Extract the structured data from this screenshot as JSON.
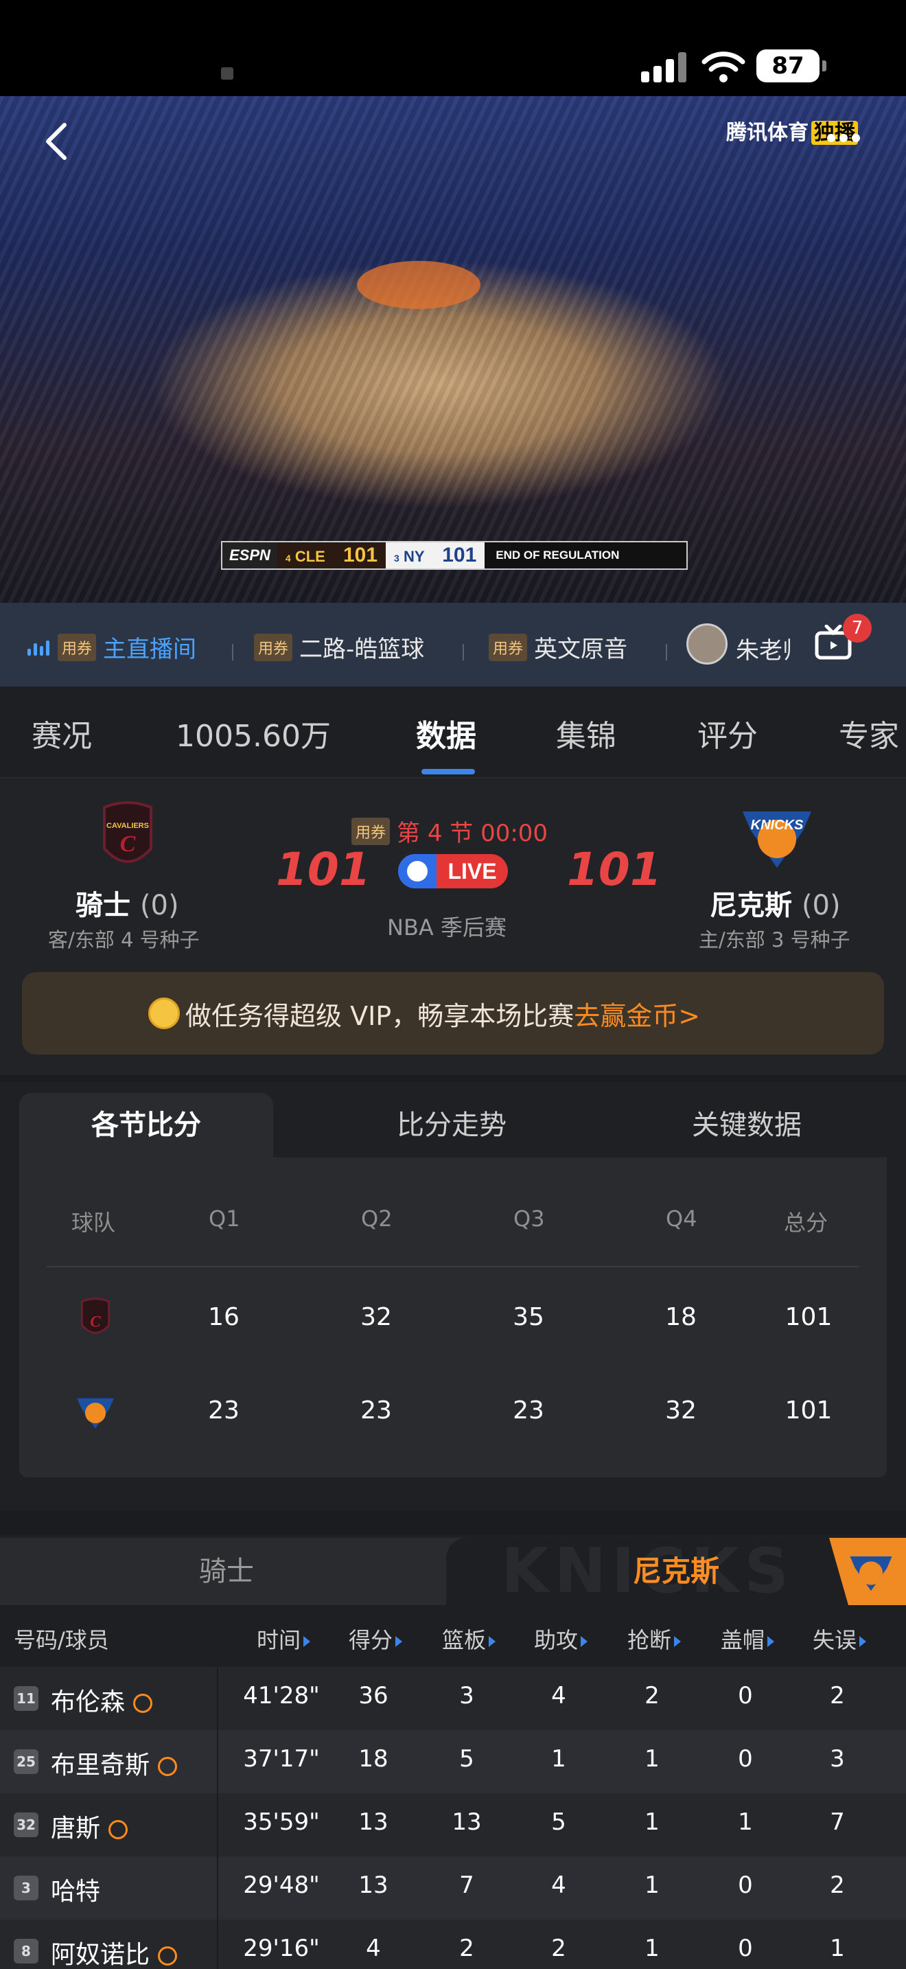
{
  "status": {
    "battery": "87"
  },
  "video": {
    "brand": "腾讯体育",
    "brand_exclusive": "独播",
    "scorebug": {
      "network": "ESPN",
      "away_seed": "4",
      "away_abbr": "CLE",
      "away_score": "101",
      "home_seed": "3",
      "home_abbr": "NY",
      "home_score": "101",
      "status": "END OF REGULATION"
    }
  },
  "streams": {
    "coupon": "用券",
    "items": [
      {
        "label": "主直播间",
        "active": true
      },
      {
        "label": "二路-皓篮球",
        "active": false
      },
      {
        "label": "英文原音",
        "active": false
      }
    ],
    "host_name": "朱老师",
    "tv_badge": "7"
  },
  "tabs": [
    "赛况",
    "1005.60万",
    "数据",
    "集锦",
    "评分",
    "专家"
  ],
  "match": {
    "coupon": "用券",
    "period": "第 4 节 00:00",
    "live": "LIVE",
    "league": "NBA 季后赛",
    "away": {
      "name": "骑士",
      "wins": "(0)",
      "sub": "客/东部 4 号种子",
      "score": "101"
    },
    "home": {
      "name": "尼克斯",
      "wins": "(0)",
      "sub": "主/东部 3 号种子",
      "score": "101"
    }
  },
  "vip": {
    "text": "做任务得超级 VIP，畅享本场比赛",
    "link": "去赢金币>"
  },
  "quarters": {
    "tabs": [
      "各节比分",
      "比分走势",
      "关键数据"
    ],
    "headers": [
      "球队",
      "Q1",
      "Q2",
      "Q3",
      "Q4",
      "总分"
    ],
    "rows": [
      {
        "team": "cavaliers",
        "values": [
          "16",
          "32",
          "35",
          "18",
          "101"
        ]
      },
      {
        "team": "knicks",
        "values": [
          "23",
          "23",
          "23",
          "32",
          "101"
        ]
      }
    ]
  },
  "players": {
    "tab_away": "骑士",
    "tab_home": "尼克斯",
    "watermark": "KNICKS",
    "headers": [
      "号码/球员",
      "时间",
      "得分",
      "篮板",
      "助攻",
      "抢断",
      "盖帽",
      "失误"
    ],
    "rows": [
      {
        "num": "11",
        "name": "布伦森",
        "starter": true,
        "time": "41'28\"",
        "pts": "36",
        "reb": "3",
        "ast": "4",
        "stl": "2",
        "blk": "0",
        "tov": "2"
      },
      {
        "num": "25",
        "name": "布里奇斯",
        "starter": true,
        "time": "37'17\"",
        "pts": "18",
        "reb": "5",
        "ast": "1",
        "stl": "1",
        "blk": "0",
        "tov": "3"
      },
      {
        "num": "32",
        "name": "唐斯",
        "starter": true,
        "time": "35'59\"",
        "pts": "13",
        "reb": "13",
        "ast": "5",
        "stl": "1",
        "blk": "1",
        "tov": "7"
      },
      {
        "num": "3",
        "name": "哈特",
        "starter": false,
        "time": "29'48\"",
        "pts": "13",
        "reb": "7",
        "ast": "4",
        "stl": "1",
        "blk": "0",
        "tov": "2"
      },
      {
        "num": "8",
        "name": "阿奴诺比",
        "starter": true,
        "time": "29'16\"",
        "pts": "4",
        "reb": "2",
        "ast": "2",
        "stl": "1",
        "blk": "0",
        "tov": "1"
      }
    ]
  },
  "colors": {
    "accent_blue": "#3b86e8",
    "score_red": "#e94545",
    "orange": "#ff8a1e"
  }
}
